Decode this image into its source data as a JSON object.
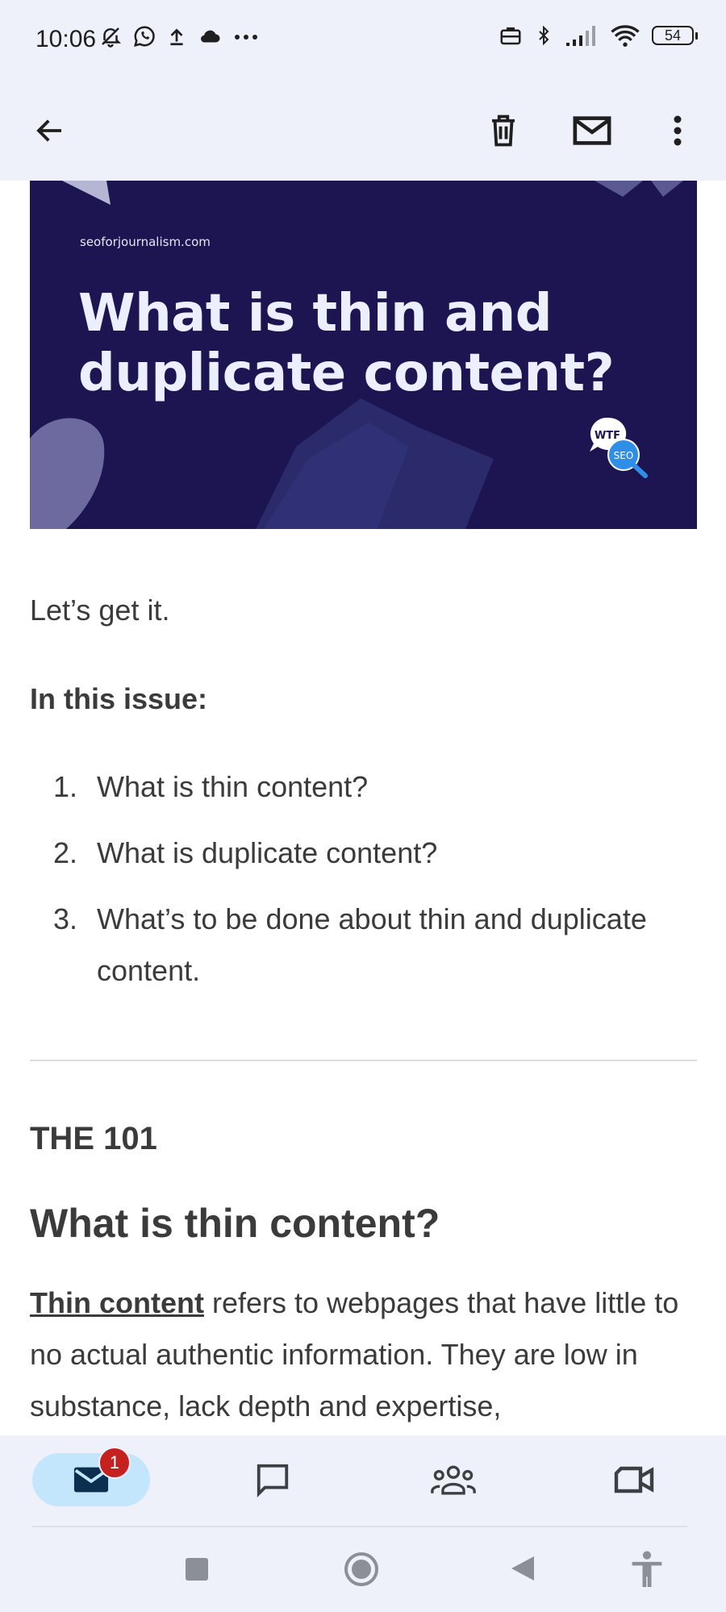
{
  "status_bar": {
    "time": "10:06",
    "battery": "54"
  },
  "hero": {
    "site": "seoforjournalism.com",
    "title": "What is thin and duplicate content?",
    "bubble_top": "WTF",
    "bubble_bottom": "SEO"
  },
  "email": {
    "intro": "Let’s get it.",
    "issue_heading": "In this issue:",
    "issue_items": [
      {
        "num": "1.",
        "text": "What is thin content?"
      },
      {
        "num": "2.",
        "text": "What is duplicate content?"
      },
      {
        "num": "3.",
        "text": "What’s to be done about thin and duplicate content."
      }
    ],
    "section_eyebrow": "THE 101",
    "section_title": "What is thin content?",
    "paragraph_link": "Thin content",
    "paragraph_rest": " refers to webpages that have little to no actual authentic information. They are low in substance, lack depth and expertise,"
  },
  "bottom_nav": {
    "mail_badge": "1"
  },
  "colors": {
    "chrome_bg": "#eef1f9",
    "hero_bg": "#1c1552",
    "active_pill": "#c4e6fc",
    "badge": "#c5221f"
  }
}
